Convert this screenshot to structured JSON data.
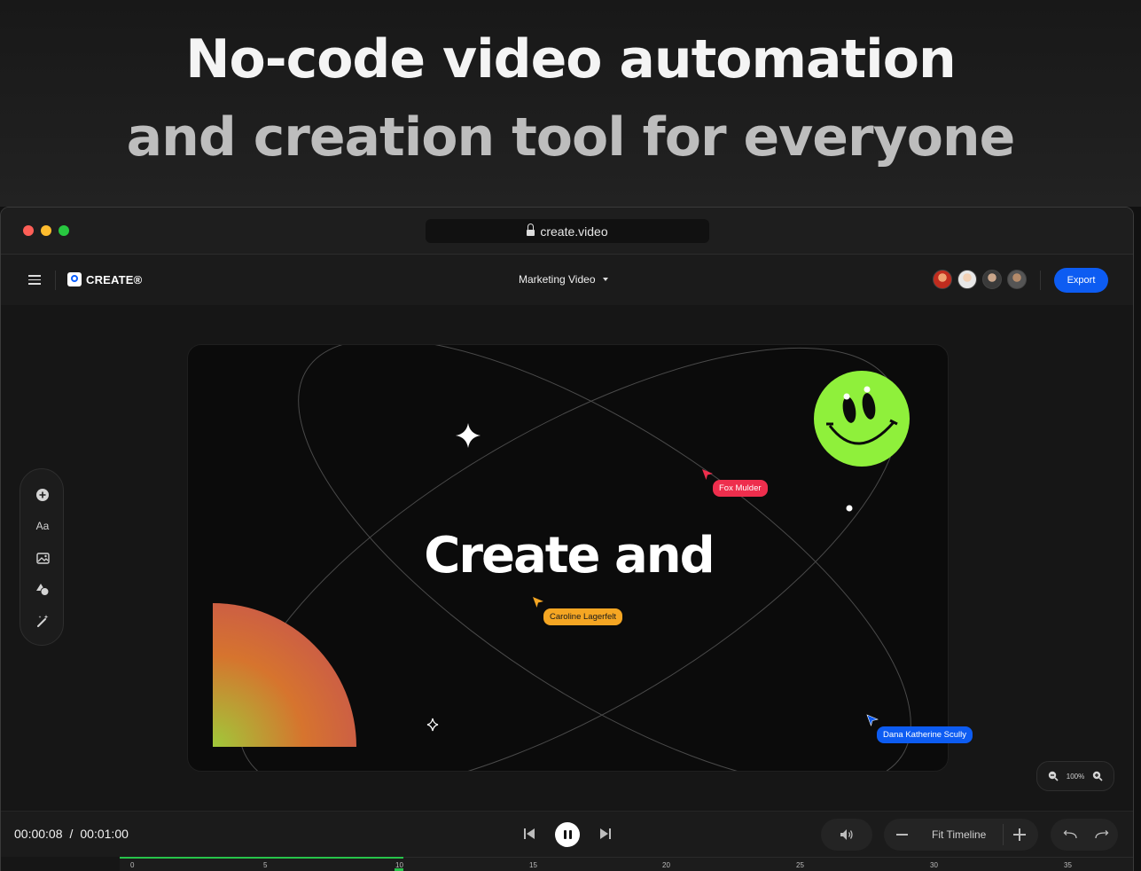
{
  "hero": {
    "line1": "No-code video automation",
    "line2": "and creation tool for everyone"
  },
  "browser": {
    "url": "create.video"
  },
  "app": {
    "logo_text": "CREATE®",
    "project_name": "Marketing Video",
    "export_label": "Export",
    "collaborators": [
      "avatar-1",
      "avatar-2",
      "avatar-3",
      "avatar-4"
    ]
  },
  "canvas": {
    "title": "Create and",
    "cursors": [
      {
        "name": "Fox Mulder",
        "color": "#ee2e4d"
      },
      {
        "name": "Caroline Lagerfelt",
        "color": "#f5a623"
      },
      {
        "name": "Dana Katherine Scully",
        "color": "#0d5cf2"
      }
    ]
  },
  "tools": [
    {
      "icon": "add-circle-icon",
      "label": ""
    },
    {
      "icon": "text-icon",
      "label": "Aa"
    },
    {
      "icon": "image-icon",
      "label": ""
    },
    {
      "icon": "shapes-icon",
      "label": ""
    },
    {
      "icon": "magic-wand-icon",
      "label": ""
    }
  ],
  "zoom": {
    "value": "100%"
  },
  "player": {
    "current_time": "00:00:08",
    "separator": "/",
    "total_time": "00:01:00",
    "fit_label": "Fit Timeline"
  },
  "timeline": {
    "ticks": [
      "0",
      "5",
      "10",
      "15",
      "20",
      "25",
      "30",
      "35"
    ],
    "progress": 0.133
  },
  "colors": {
    "accent": "#0d5cf2",
    "smiley": "#8ff03b",
    "progress": "#27c44a"
  }
}
